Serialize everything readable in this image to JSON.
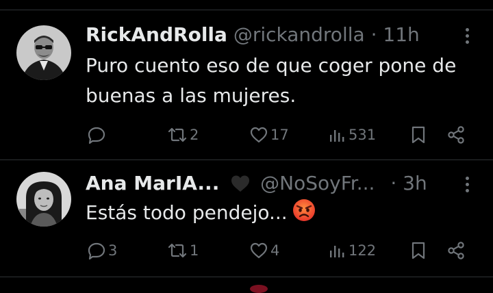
{
  "tweets": [
    {
      "name": "RickAndRolla",
      "handle": "@rickandrolla",
      "separator": "·",
      "time": "11h",
      "text": "Puro cuento eso de que coger pone de buenas a las mujeres.",
      "avatar_icon": "man-sunglasses-avatar",
      "replies": "",
      "retweets": "2",
      "likes": "17",
      "views": "531"
    },
    {
      "name": "Ana MarIA...",
      "name_badge_icon": "black-heart-icon",
      "handle": "@NoSoyFr...",
      "separator": "·",
      "time": "3h",
      "text": "Estás todo pendejo...",
      "emoji_icon": "angry-face-emoji",
      "avatar_icon": "woman-avatar",
      "replies": "3",
      "retweets": "1",
      "likes": "4",
      "views": "122"
    }
  ],
  "colors": {
    "background": "#000000",
    "text": "#e7e9ea",
    "muted": "#71767b",
    "divider": "#2f3336"
  }
}
